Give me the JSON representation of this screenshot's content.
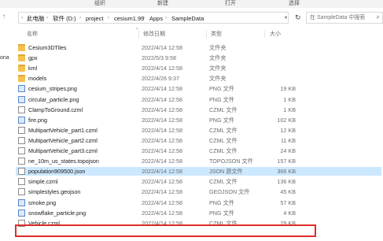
{
  "ribbon": {
    "items": [
      "组织",
      "新建",
      "打开",
      "选择"
    ]
  },
  "nav": {
    "back_icon": "arrow-left-icon",
    "up_icon": "arrow-up-icon"
  },
  "breadcrumb": [
    "此电脑",
    "软件 (D:)",
    "project",
    "cesium1.99",
    "Apps",
    "SampleData"
  ],
  "search": {
    "placeholder": "在 SampleData 中搜索"
  },
  "left_pane": {
    "items": [
      "ona"
    ]
  },
  "columns": {
    "name": "名称",
    "date": "修改日期",
    "type": "类型",
    "size": "大小"
  },
  "files": [
    {
      "name": "Cesium3DTiles",
      "date": "2022/4/14 12:58",
      "type": "文件夹",
      "size": "",
      "icon": "folder"
    },
    {
      "name": "gpx",
      "date": "2022/5/3 9:58",
      "type": "文件夹",
      "size": "",
      "icon": "folder"
    },
    {
      "name": "kml",
      "date": "2022/4/14 12:58",
      "type": "文件夹",
      "size": "",
      "icon": "folder"
    },
    {
      "name": "models",
      "date": "2022/4/26 9:37",
      "type": "文件夹",
      "size": "",
      "icon": "folder"
    },
    {
      "name": "cesium_stripes.png",
      "date": "2022/4/14 12:58",
      "type": "PNG 文件",
      "size": "19 KB",
      "icon": "png"
    },
    {
      "name": "circular_particle.png",
      "date": "2022/4/14 12:58",
      "type": "PNG 文件",
      "size": "1 KB",
      "icon": "png"
    },
    {
      "name": "ClampToGround.czml",
      "date": "2022/4/14 12:58",
      "type": "CZML 文件",
      "size": "1 KB",
      "icon": "file"
    },
    {
      "name": "fire.png",
      "date": "2022/4/14 12:58",
      "type": "PNG 文件",
      "size": "102 KB",
      "icon": "png"
    },
    {
      "name": "MultipartVehicle_part1.czml",
      "date": "2022/4/14 12:58",
      "type": "CZML 文件",
      "size": "12 KB",
      "icon": "file"
    },
    {
      "name": "MultipartVehicle_part2.czml",
      "date": "2022/4/14 12:58",
      "type": "CZML 文件",
      "size": "11 KB",
      "icon": "file"
    },
    {
      "name": "MultipartVehicle_part3.czml",
      "date": "2022/4/14 12:58",
      "type": "CZML 文件",
      "size": "24 KB",
      "icon": "file"
    },
    {
      "name": "ne_10m_us_states.topojson",
      "date": "2022/4/14 12:58",
      "type": "TOPOJSON 文件",
      "size": "157 KB",
      "icon": "file"
    },
    {
      "name": "population909500.json",
      "date": "2022/4/14 12:58",
      "type": "JSON 源文件",
      "size": "366 KB",
      "icon": "file"
    },
    {
      "name": "simple.czml",
      "date": "2022/4/14 12:58",
      "type": "CZML 文件",
      "size": "136 KB",
      "icon": "file"
    },
    {
      "name": "simplestyles.geojson",
      "date": "2022/4/14 12:58",
      "type": "GEOJSON 文件",
      "size": "45 KB",
      "icon": "file"
    },
    {
      "name": "smoke.png",
      "date": "2022/4/14 12:58",
      "type": "PNG 文件",
      "size": "57 KB",
      "icon": "png"
    },
    {
      "name": "snowflake_particle.png",
      "date": "2022/4/14 12:58",
      "type": "PNG 文件",
      "size": "4 KB",
      "icon": "png"
    },
    {
      "name": "Vehicle.czml",
      "date": "2022/4/14 12:58",
      "type": "CZML 文件",
      "size": "29 KB",
      "icon": "file"
    }
  ],
  "selected_row": 12,
  "highlighted_row": 17,
  "colors": {
    "selection": "#cce8ff",
    "annotation_border": "#e02c2c",
    "folder": "#f3c24f"
  }
}
